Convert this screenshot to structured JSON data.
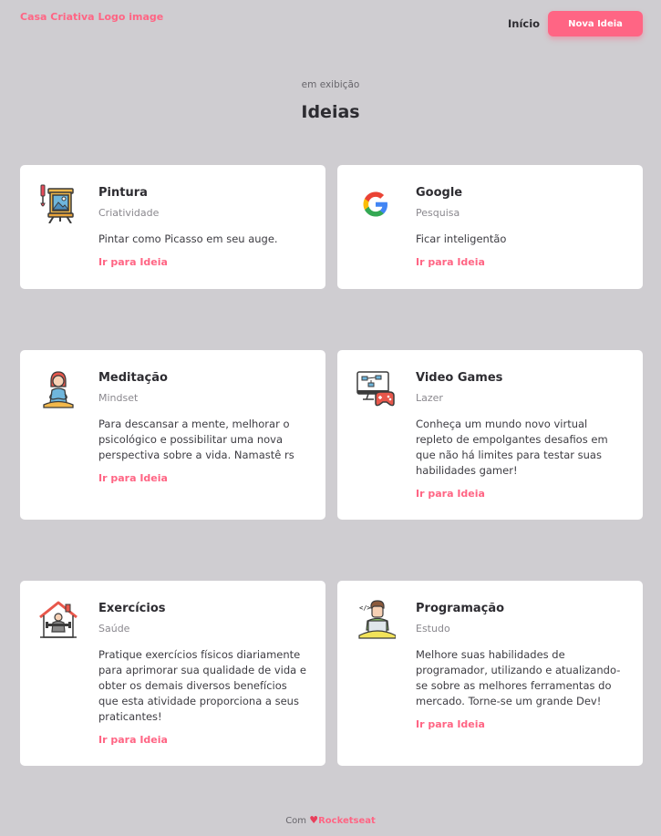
{
  "header": {
    "logo_alt": "Casa Criativa Logo image",
    "nav_home": "Início",
    "new_idea_button": "Nova Ideia"
  },
  "section": {
    "subtitle": "em exibição",
    "title": "Ideias"
  },
  "colors": {
    "accent": "#ff6584",
    "background": "#cfcdd1",
    "card": "#ffffff"
  },
  "ideas": [
    {
      "icon": "painting-easel-icon",
      "title": "Pintura",
      "category": "Criatividade",
      "description": "Pintar como Picasso em seu auge.",
      "link": "Ir para Ideia"
    },
    {
      "icon": "google-logo-icon",
      "title": "Google",
      "category": "Pesquisa",
      "description": "Ficar inteligentão",
      "link": "Ir para Ideia"
    },
    {
      "icon": "meditation-icon",
      "title": "Meditação",
      "category": "Mindset",
      "description": "Para descansar a mente, melhorar o psicológico e possibilitar uma nova perspectiva sobre a vida. Namastê rs",
      "link": "Ir para Ideia"
    },
    {
      "icon": "video-games-icon",
      "title": "Video Games",
      "category": "Lazer",
      "description": "Conheça um mundo novo virtual repleto de empolgantes desafios em que não há limites para testar suas habilidades gamer!",
      "link": "Ir para Ideia"
    },
    {
      "icon": "home-workout-icon",
      "title": "Exercícios",
      "category": "Saúde",
      "description": "Pratique exercícios físicos diariamente para aprimorar sua qualidade de vida e obter os demais diversos benefícios que esta atividade proporciona a seus praticantes!",
      "link": "Ir para Ideia"
    },
    {
      "icon": "programmer-icon",
      "title": "Programação",
      "category": "Estudo",
      "description": "Melhore suas habilidades de programador, utilizando e atualizando-se sobre as melhores ferramentas do mercado. Torne-se um grande Dev!",
      "link": "Ir para Ideia"
    }
  ],
  "footer": {
    "prefix": "Com",
    "brand": "Rocketseat"
  }
}
